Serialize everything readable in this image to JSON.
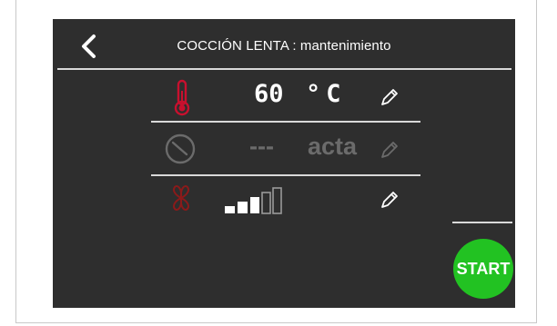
{
  "header": {
    "title": "COCCIÓN LENTA : mantenimiento",
    "back_icon": "chevron-left-icon"
  },
  "rows": [
    {
      "icon": "thermometer-icon",
      "value": "60",
      "unit": "°C",
      "edit_icon": "pencil-icon"
    },
    {
      "icon": "clock-icon",
      "value": "---",
      "unit": "acta",
      "edit_icon": "pencil-icon"
    },
    {
      "icon": "fan-icon",
      "level_icon": "signal-level-icon",
      "level": 3,
      "level_max": 5,
      "edit_icon": "pencil-icon"
    }
  ],
  "start": {
    "label": "START"
  },
  "colors": {
    "background": "#2e2e2e",
    "accent_red": "#c8102e",
    "fan_red": "#8b1a1a",
    "start_green": "#22c222",
    "dim_gray": "#6b6b6b"
  }
}
